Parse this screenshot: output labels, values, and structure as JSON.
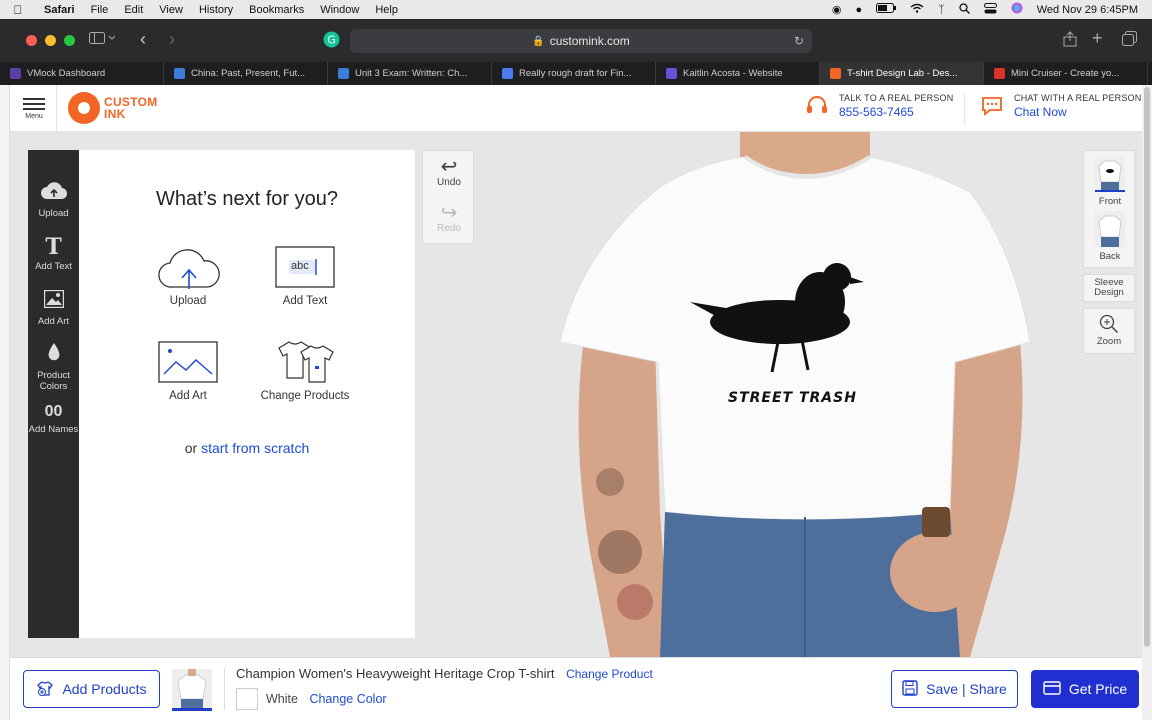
{
  "menubar": {
    "app": "Safari",
    "items": [
      "File",
      "Edit",
      "View",
      "History",
      "Bookmarks",
      "Window",
      "Help"
    ],
    "clock": "Wed Nov 29  6:45PM"
  },
  "browser": {
    "url": "customink.com",
    "tabs": [
      {
        "label": "VMock Dashboard",
        "color": "#5b3fa8"
      },
      {
        "label": "China: Past, Present, Fut...",
        "color": "#3b7dd8"
      },
      {
        "label": "Unit 3 Exam: Written: Ch...",
        "color": "#3b7dd8"
      },
      {
        "label": "Really rough draft for Fin...",
        "color": "#4a7cf0"
      },
      {
        "label": "Kaitlin Acosta - Website",
        "color": "#6a4fd8"
      },
      {
        "label": "T-shirt Design Lab - Des...",
        "color": "#f26522"
      },
      {
        "label": "Mini Cruiser - Create yo...",
        "color": "#d8342c"
      }
    ]
  },
  "site": {
    "menu_label": "Menu",
    "logo_line1": "CUSTOM",
    "logo_line2": "INK",
    "talk_label": "TALK TO A REAL PERSON",
    "phone": "855-563-7465",
    "chat_label": "CHAT WITH A REAL PERSON",
    "chat_link": "Chat Now"
  },
  "rail": [
    {
      "label": "Upload",
      "icon": "cloud-upload-icon"
    },
    {
      "label": "Add Text",
      "icon": "text-icon"
    },
    {
      "label": "Add Art",
      "icon": "image-icon"
    },
    {
      "label": "Product Colors",
      "icon": "droplet-icon"
    },
    {
      "label": "Add Names",
      "icon": "names-icon"
    }
  ],
  "panel": {
    "title": "What’s next for you?",
    "options": [
      "Upload",
      "Add Text",
      "Add Art",
      "Change Products"
    ],
    "add_text_sample": "abc",
    "scratch_prefix": "or ",
    "scratch_link": "start from scratch"
  },
  "history": {
    "undo": "Undo",
    "redo": "Redo"
  },
  "design": {
    "text": "STREET TRASH"
  },
  "views": {
    "front": "Front",
    "back": "Back",
    "sleeve": "Sleeve Design",
    "zoom": "Zoom"
  },
  "bottom": {
    "add_products": "Add Products",
    "product_name": "Champion Women's Heavyweight Heritage Crop T-shirt",
    "change_product": "Change Product",
    "color": "White",
    "change_color": "Change Color",
    "save": "Save | Share",
    "price": "Get Price"
  }
}
